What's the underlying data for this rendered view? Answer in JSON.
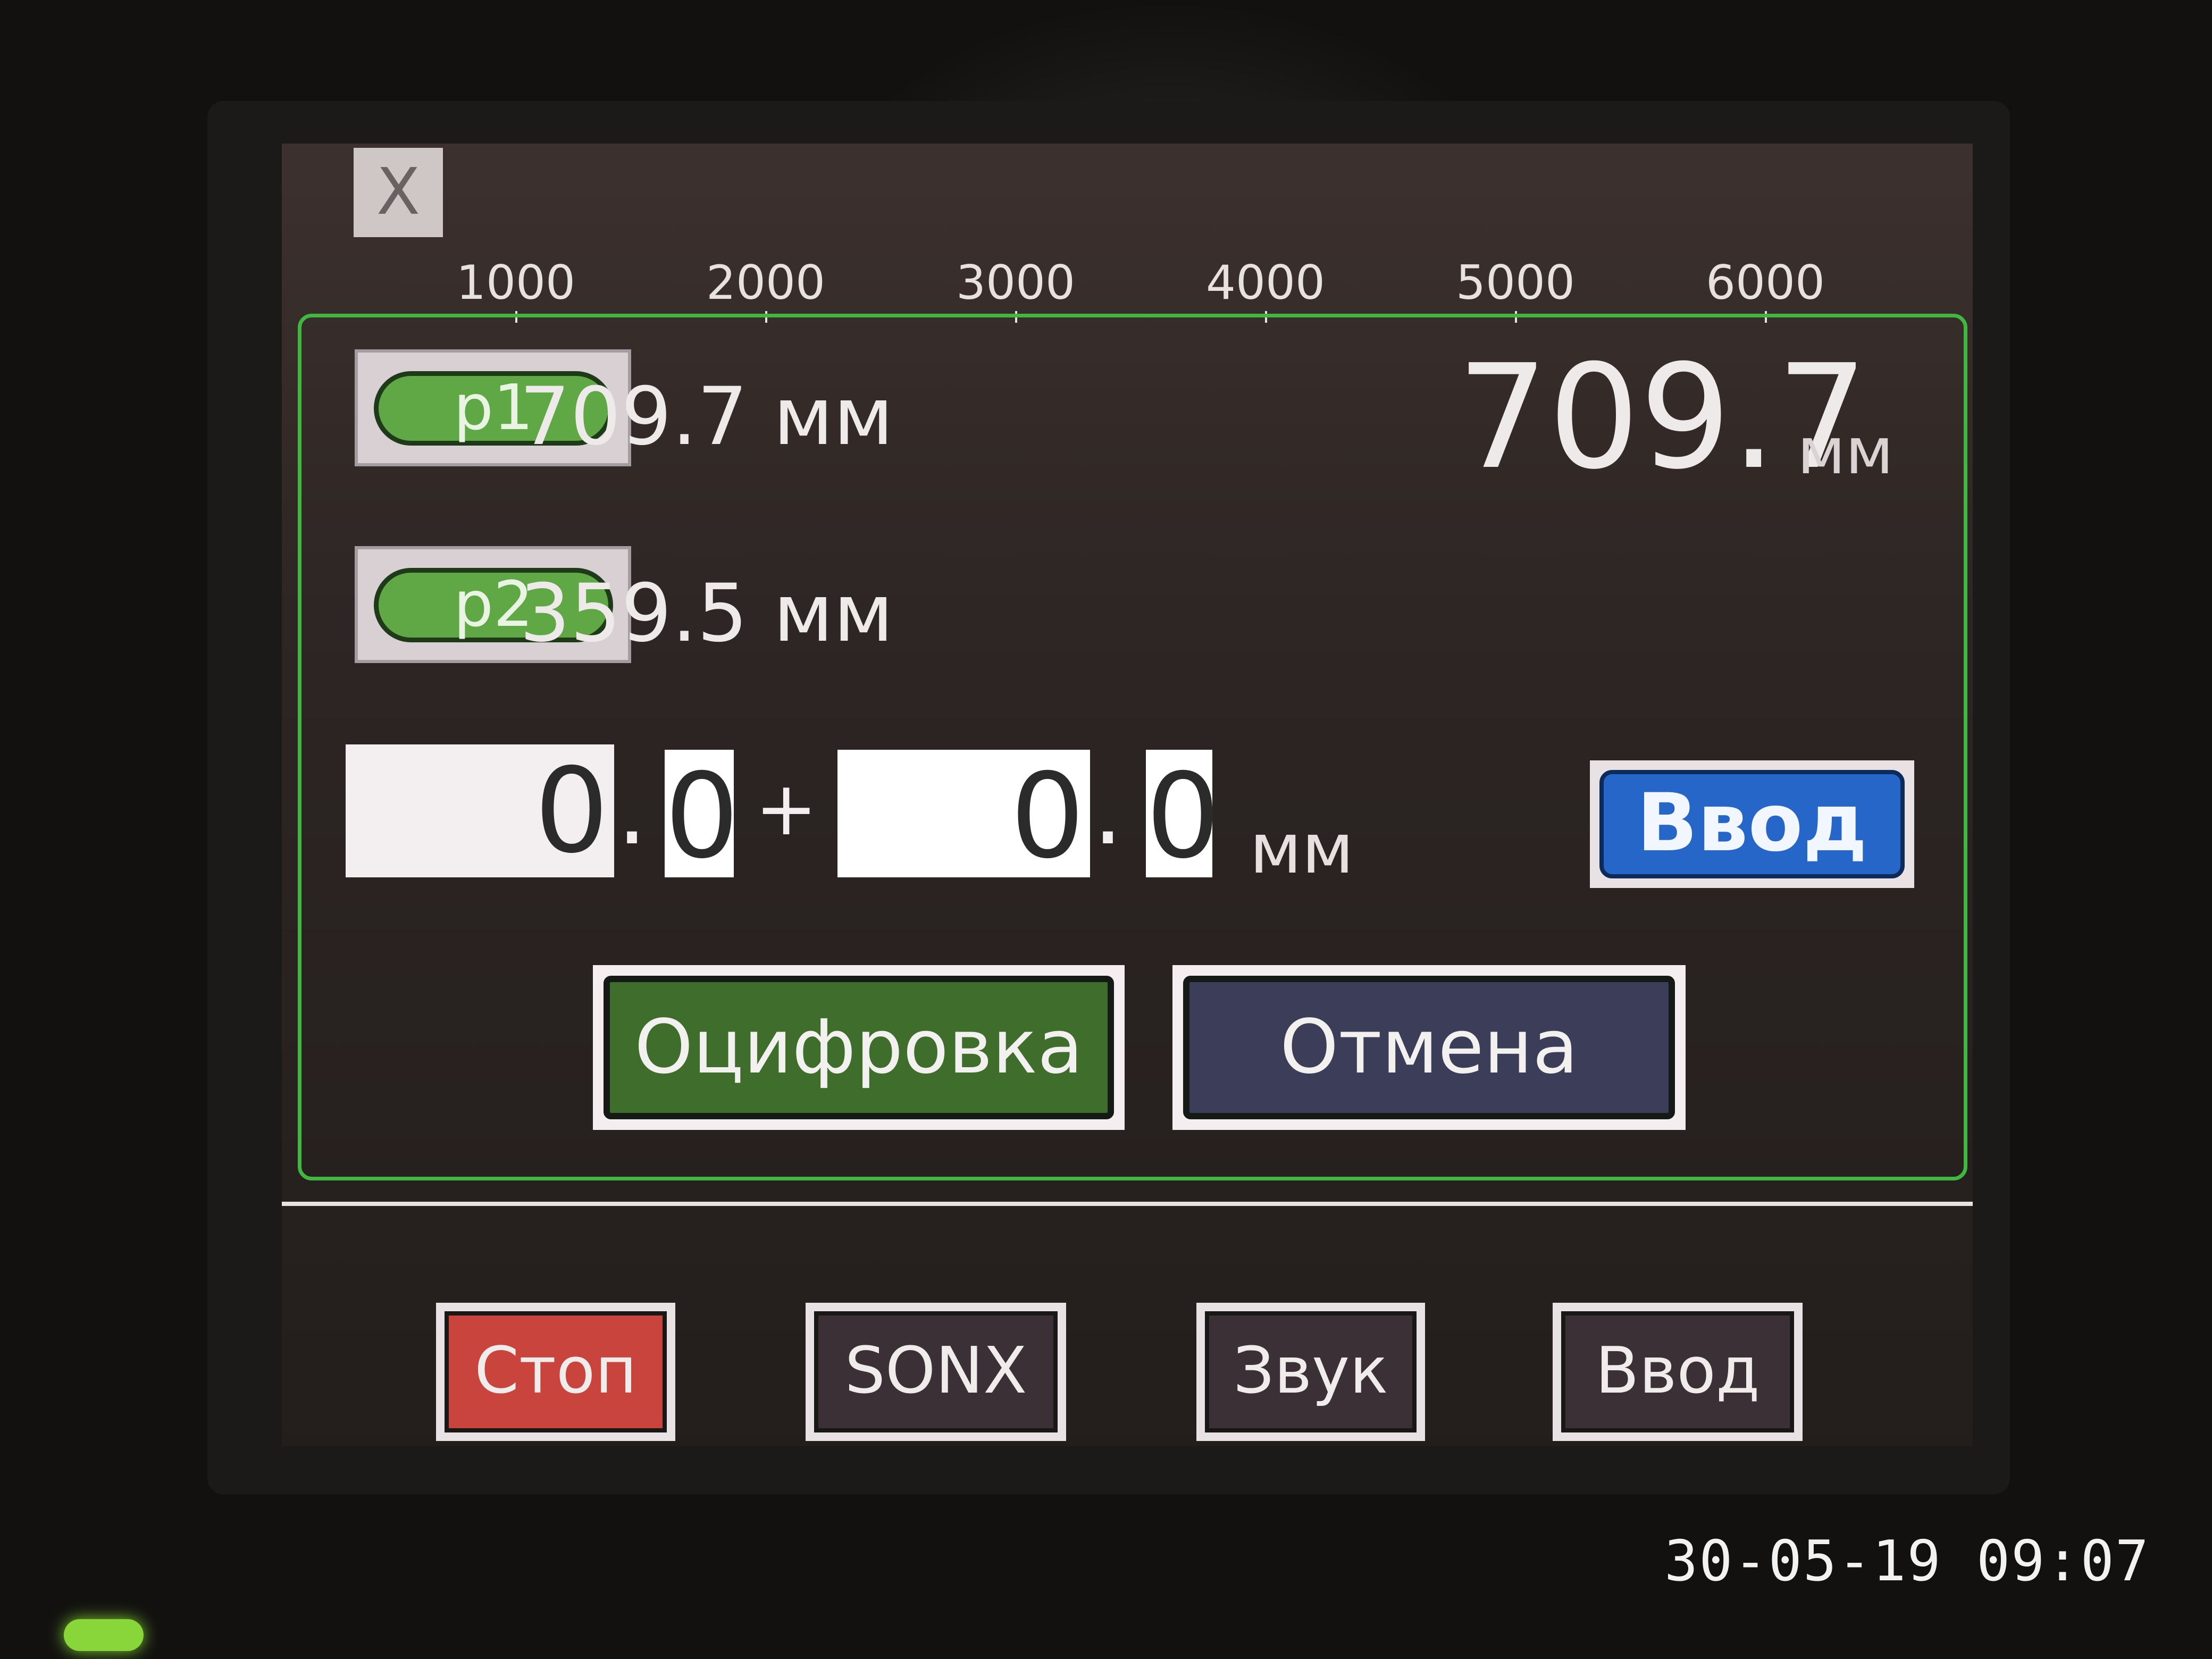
{
  "close_label": "X",
  "ruler_ticks": [
    "1000",
    "2000",
    "3000",
    "4000",
    "5000",
    "6000"
  ],
  "points": [
    {
      "label": "p1",
      "reading": "709.7 мм"
    },
    {
      "label": "p2",
      "reading": "359.5 мм"
    }
  ],
  "result": {
    "value": "709.7",
    "unit": "мм"
  },
  "input": {
    "base_int": "0",
    "base_dec": "0",
    "plus": "+",
    "offset_int": "0",
    "offset_dec": "0",
    "unit": "мм",
    "enter_label": "Ввод"
  },
  "actions": {
    "digitize_label": "Оцифровка",
    "cancel_label": "Отмена"
  },
  "bottom_bar": {
    "stop": "Стоп",
    "sonx": "SONX",
    "sound": "Звук",
    "enter": "Ввод"
  },
  "photo_timestamp": "30-05-19 09:07",
  "colors": {
    "panel_border": "#40b840",
    "p_button_green": "#5fa845",
    "enter_blue": "#2566c8",
    "digitize_green": "#3f6d2b",
    "cancel_slate": "#3b3d59",
    "stop_red": "#c8443c"
  }
}
